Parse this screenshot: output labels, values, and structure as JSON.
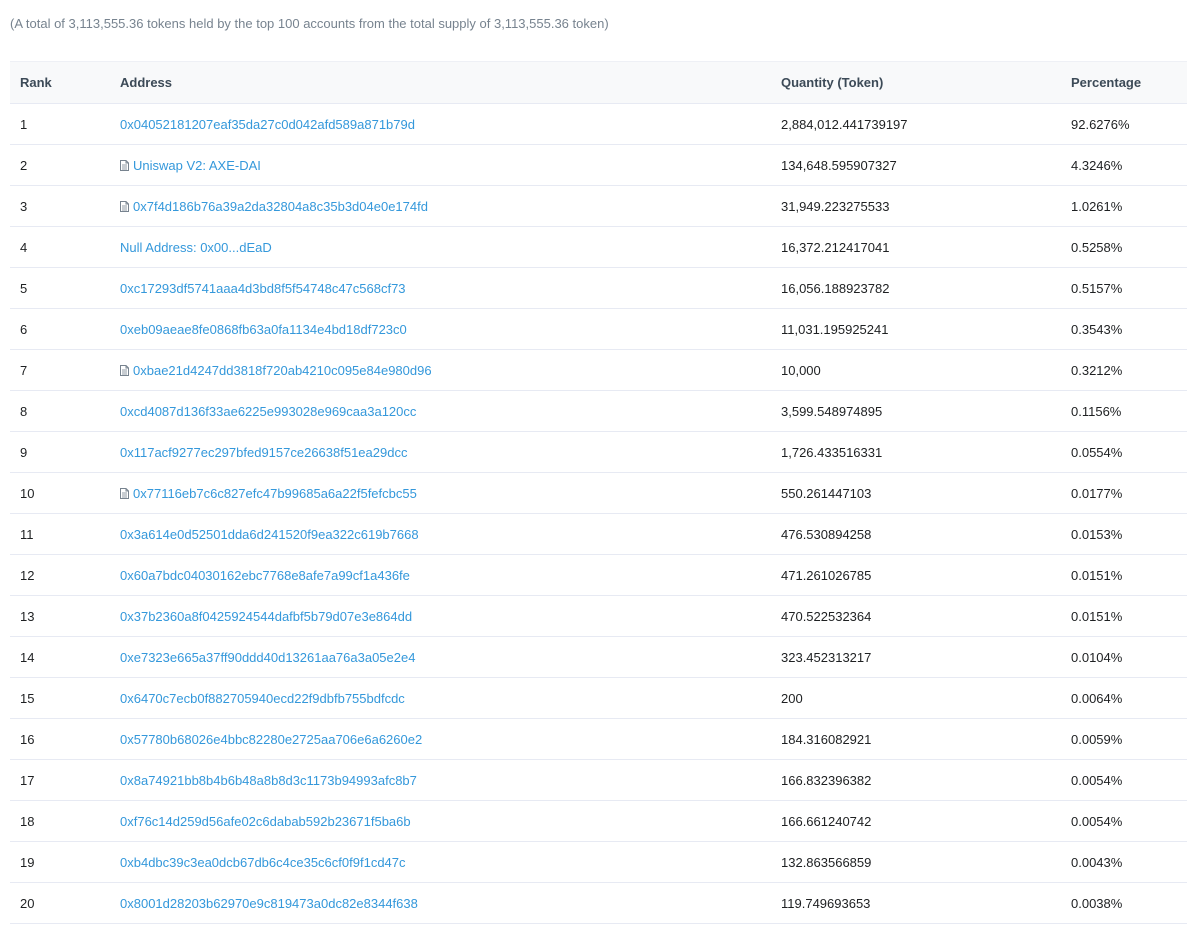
{
  "summary": "(A total of 3,113,555.36 tokens held by the top 100 accounts from the total supply of 3,113,555.36 token)",
  "headers": {
    "rank": "Rank",
    "address": "Address",
    "quantity": "Quantity (Token)",
    "percentage": "Percentage"
  },
  "rows": [
    {
      "rank": "1",
      "address": "0x04052181207eaf35da27c0d042afd589a871b79d",
      "contract": false,
      "quantity": "2,884,012.441739197",
      "percentage": "92.6276%"
    },
    {
      "rank": "2",
      "address": "Uniswap V2: AXE-DAI",
      "contract": true,
      "quantity": "134,648.595907327",
      "percentage": "4.3246%"
    },
    {
      "rank": "3",
      "address": "0x7f4d186b76a39a2da32804a8c35b3d04e0e174fd",
      "contract": true,
      "quantity": "31,949.223275533",
      "percentage": "1.0261%"
    },
    {
      "rank": "4",
      "address": "Null Address: 0x00...dEaD",
      "contract": false,
      "quantity": "16,372.212417041",
      "percentage": "0.5258%"
    },
    {
      "rank": "5",
      "address": "0xc17293df5741aaa4d3bd8f5f54748c47c568cf73",
      "contract": false,
      "quantity": "16,056.188923782",
      "percentage": "0.5157%"
    },
    {
      "rank": "6",
      "address": "0xeb09aeae8fe0868fb63a0fa1134e4bd18df723c0",
      "contract": false,
      "quantity": "11,031.195925241",
      "percentage": "0.3543%"
    },
    {
      "rank": "7",
      "address": "0xbae21d4247dd3818f720ab4210c095e84e980d96",
      "contract": true,
      "quantity": "10,000",
      "percentage": "0.3212%"
    },
    {
      "rank": "8",
      "address": "0xcd4087d136f33ae6225e993028e969caa3a120cc",
      "contract": false,
      "quantity": "3,599.548974895",
      "percentage": "0.1156%"
    },
    {
      "rank": "9",
      "address": "0x117acf9277ec297bfed9157ce26638f51ea29dcc",
      "contract": false,
      "quantity": "1,726.433516331",
      "percentage": "0.0554%"
    },
    {
      "rank": "10",
      "address": "0x77116eb7c6c827efc47b99685a6a22f5fefcbc55",
      "contract": true,
      "quantity": "550.261447103",
      "percentage": "0.0177%"
    },
    {
      "rank": "11",
      "address": "0x3a614e0d52501dda6d241520f9ea322c619b7668",
      "contract": false,
      "quantity": "476.530894258",
      "percentage": "0.0153%"
    },
    {
      "rank": "12",
      "address": "0x60a7bdc04030162ebc7768e8afe7a99cf1a436fe",
      "contract": false,
      "quantity": "471.261026785",
      "percentage": "0.0151%"
    },
    {
      "rank": "13",
      "address": "0x37b2360a8f0425924544dafbf5b79d07e3e864dd",
      "contract": false,
      "quantity": "470.522532364",
      "percentage": "0.0151%"
    },
    {
      "rank": "14",
      "address": "0xe7323e665a37ff90ddd40d13261aa76a3a05e2e4",
      "contract": false,
      "quantity": "323.452313217",
      "percentage": "0.0104%"
    },
    {
      "rank": "15",
      "address": "0x6470c7ecb0f882705940ecd22f9dbfb755bdfcdc",
      "contract": false,
      "quantity": "200",
      "percentage": "0.0064%"
    },
    {
      "rank": "16",
      "address": "0x57780b68026e4bbc82280e2725aa706e6a6260e2",
      "contract": false,
      "quantity": "184.316082921",
      "percentage": "0.0059%"
    },
    {
      "rank": "17",
      "address": "0x8a74921bb8b4b6b48a8b8d3c1173b94993afc8b7",
      "contract": false,
      "quantity": "166.832396382",
      "percentage": "0.0054%"
    },
    {
      "rank": "18",
      "address": "0xf76c14d259d56afe02c6dabab592b23671f5ba6b",
      "contract": false,
      "quantity": "166.661240742",
      "percentage": "0.0054%"
    },
    {
      "rank": "19",
      "address": "0xb4dbc39c3ea0dcb67db6c4ce35c6cf0f9f1cd47c",
      "contract": false,
      "quantity": "132.863566859",
      "percentage": "0.0043%"
    },
    {
      "rank": "20",
      "address": "0x8001d28203b62970e9c819473a0dc82e8344f638",
      "contract": false,
      "quantity": "119.749693653",
      "percentage": "0.0038%"
    }
  ]
}
